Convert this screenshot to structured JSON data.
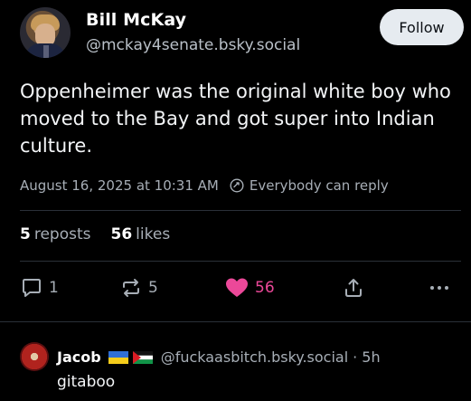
{
  "post": {
    "author_name": "Bill McKay",
    "author_handle": "@mckay4senate.bsky.social",
    "follow_label": "Follow",
    "text": "Oppenheimer was the original white boy who moved to the Bay and got super into Indian culture.",
    "timestamp": "August 16, 2025 at 10:31 AM",
    "reply_setting": "Everybody can reply",
    "reposts_count": "5",
    "reposts_label": "reposts",
    "likes_count": "56",
    "likes_label": "likes",
    "actions": {
      "reply_count": "1",
      "repost_count": "5",
      "like_count": "56"
    }
  },
  "reply": {
    "author_name": "Jacob",
    "author_handle": "@fuckaasbitch.bsky.social",
    "time_sep": "·",
    "time": "5h",
    "text": "gitaboo"
  },
  "colors": {
    "background": "#000000",
    "muted_text": "#a7aeb6",
    "like_pink": "#ec4899",
    "follow_bg": "#e6ebf0"
  }
}
